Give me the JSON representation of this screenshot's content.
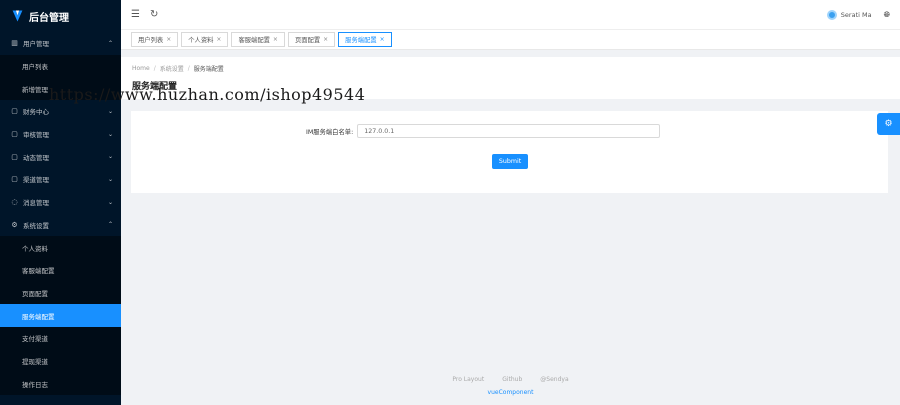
{
  "app": {
    "title": "后台管理"
  },
  "sidebar": {
    "groups": [
      {
        "label": "用户管理",
        "icon": "table-icon",
        "arrow": "⌃"
      },
      {
        "label": "财务中心",
        "icon": "file-icon",
        "arrow": "⌄"
      },
      {
        "label": "审核管理",
        "icon": "square-icon",
        "arrow": "⌄"
      },
      {
        "label": "动态管理",
        "icon": "square-icon",
        "arrow": "⌄"
      },
      {
        "label": "渠道管理",
        "icon": "square-icon",
        "arrow": "⌄"
      },
      {
        "label": "消息管理",
        "icon": "message-icon",
        "arrow": "⌄"
      },
      {
        "label": "系统设置",
        "icon": "gear-icon",
        "arrow": "⌃"
      }
    ],
    "user_items": [
      "用户列表",
      "新增管理"
    ],
    "system_items": [
      "个人资料",
      "客服端配置",
      "页面配置",
      "服务端配置",
      "支付渠道",
      "提现渠道",
      "操作日志"
    ]
  },
  "header": {
    "username": "Serati Ma"
  },
  "tabs": [
    {
      "label": "用户列表"
    },
    {
      "label": "个人资料"
    },
    {
      "label": "客服端配置"
    },
    {
      "label": "页面配置"
    },
    {
      "label": "服务端配置"
    }
  ],
  "breadcrumb": {
    "home": "Home",
    "parent": "系统设置",
    "current": "服务端配置"
  },
  "page": {
    "title": "服务端配置"
  },
  "form": {
    "label": "IM服务端白名单:",
    "value": "127.0.0.1",
    "submit": "Submit"
  },
  "footer": {
    "links": [
      "Pro Layout",
      "Github",
      "@Sendya"
    ],
    "copyright": "vueComponent"
  },
  "watermark": "https://www.huzhan.com/ishop49544",
  "colors": {
    "primary": "#1890ff",
    "sider": "#001529"
  }
}
